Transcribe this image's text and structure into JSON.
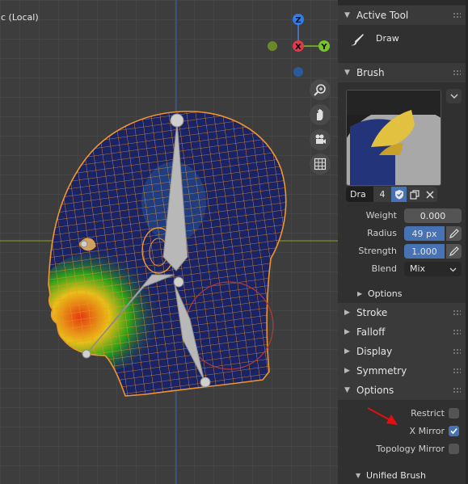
{
  "viewport": {
    "label": "c (Local)",
    "gizmo": {
      "z": "Z",
      "x": "X",
      "y": "Y"
    },
    "nav_icons": [
      "zoom-icon",
      "hand-icon",
      "camera-icon",
      "grid-icon"
    ]
  },
  "panel": {
    "active_tool": {
      "header": "Active Tool",
      "tool_name": "Draw"
    },
    "brush": {
      "header": "Brush",
      "name": "Dra",
      "users": "4",
      "props": {
        "weight_label": "Weight",
        "weight_value": "0.000",
        "radius_label": "Radius",
        "radius_value": "49 px",
        "strength_label": "Strength",
        "strength_value": "1.000",
        "blend_label": "Blend",
        "blend_value": "Mix"
      },
      "options_sub": "Options"
    },
    "sections": {
      "stroke": "Stroke",
      "falloff": "Falloff",
      "display": "Display",
      "symmetry": "Symmetry",
      "options": "Options"
    },
    "options": {
      "restrict_label": "Restrict",
      "restrict_checked": false,
      "xmirror_label": "X Mirror",
      "xmirror_checked": true,
      "topology_label": "Topology Mirror",
      "topology_checked": false,
      "unified_brush": "Unified Brush"
    }
  },
  "colors": {
    "accent": "#4772b3",
    "wire": "#f0952a",
    "annotation_arrow": "#e01010"
  }
}
